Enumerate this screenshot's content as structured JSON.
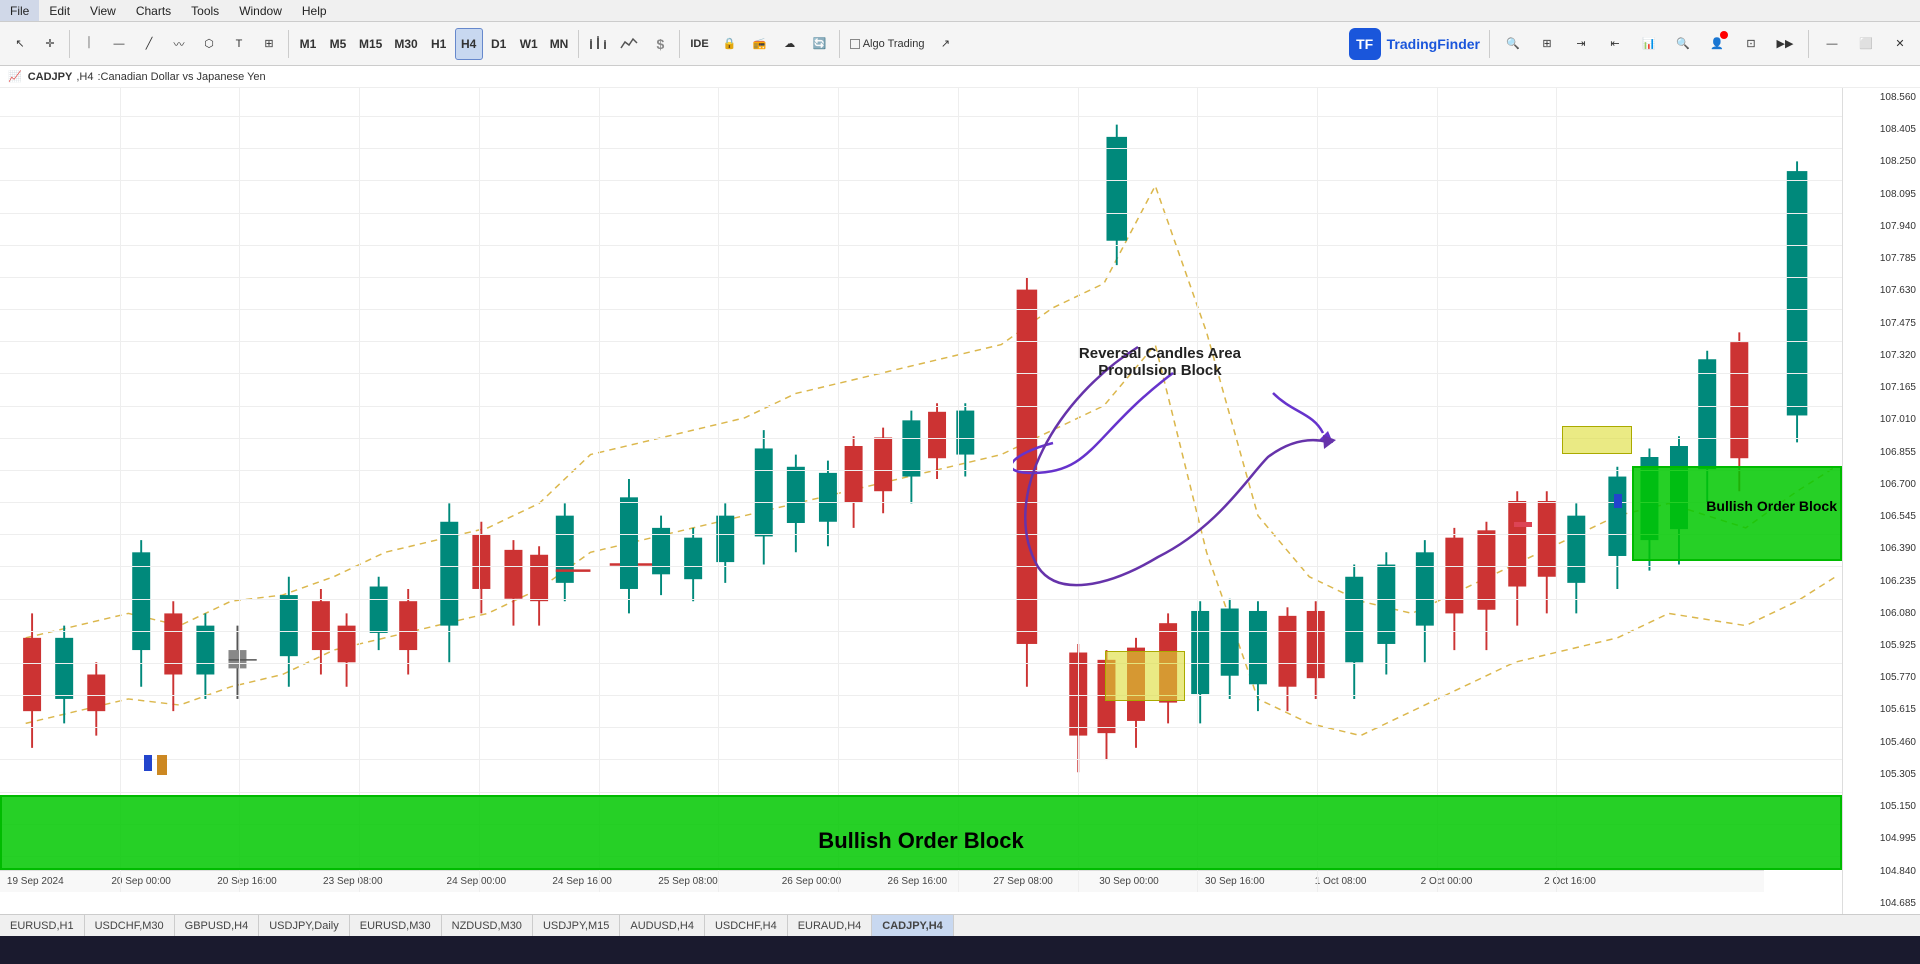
{
  "menu": {
    "items": [
      "File",
      "Edit",
      "View",
      "Charts",
      "Tools",
      "Window",
      "Help"
    ]
  },
  "toolbar": {
    "tools": [
      {
        "name": "cursor",
        "label": "↖",
        "active": false
      },
      {
        "name": "crosshair",
        "label": "✛",
        "active": false
      },
      {
        "name": "line-v",
        "label": "⏐",
        "active": false
      },
      {
        "name": "line-h",
        "label": "—",
        "active": false
      },
      {
        "name": "line-diag",
        "label": "╱",
        "active": false
      },
      {
        "name": "path",
        "label": "〰",
        "active": false
      },
      {
        "name": "shapes",
        "label": "⬡",
        "active": false
      },
      {
        "name": "text",
        "label": "T",
        "active": false
      },
      {
        "name": "fibonacci",
        "label": "⊞",
        "active": false
      }
    ],
    "timeframes": [
      "M1",
      "M5",
      "M15",
      "M30",
      "H1",
      "H4",
      "D1",
      "W1",
      "MN"
    ],
    "active_tf": "H4",
    "right_tools": [
      "IDE",
      "🔒",
      "📻",
      "☁",
      "🔄",
      "Algo Trading",
      "↗"
    ],
    "logo_text": "TradingFinder"
  },
  "chart_header": {
    "symbol": "CADJPY",
    "timeframe": "H4",
    "description": "Canadian Dollar vs Japanese Yen"
  },
  "price_axis": {
    "labels": [
      "108.560",
      "108.405",
      "108.250",
      "108.095",
      "107.940",
      "107.785",
      "107.630",
      "107.475",
      "107.320",
      "107.165",
      "107.010",
      "106.855",
      "106.700",
      "106.545",
      "106.390",
      "106.235",
      "106.080",
      "105.925",
      "105.770",
      "105.615",
      "105.460",
      "105.305",
      "105.150",
      "104.995",
      "104.840",
      "104.685"
    ]
  },
  "time_axis": {
    "labels": [
      {
        "text": "19 Sep 2024",
        "pct": 2
      },
      {
        "text": "20 Sep 00:00",
        "pct": 8
      },
      {
        "text": "20 Sep 16:00",
        "pct": 14
      },
      {
        "text": "23 Sep 08:00",
        "pct": 20
      },
      {
        "text": "24 Sep 00:00",
        "pct": 26
      },
      {
        "text": "24 Sep 16:00",
        "pct": 32
      },
      {
        "text": "25 Sep 08:00",
        "pct": 38
      },
      {
        "text": "26 Sep 00:00",
        "pct": 44
      },
      {
        "text": "26 Sep 16:00",
        "pct": 50
      },
      {
        "text": "27 Sep 08:00",
        "pct": 56
      },
      {
        "text": "30 Sep 00:00",
        "pct": 62
      },
      {
        "text": "30 Sep 16:00",
        "pct": 68
      },
      {
        "text": "1 Oct 08:00",
        "pct": 74
      },
      {
        "text": "2 Oct 00:00",
        "pct": 80
      },
      {
        "text": "2 Oct 16:00",
        "pct": 87
      }
    ]
  },
  "annotations": {
    "bullish_order_block_bottom_label": "Bullish Order Block",
    "bullish_order_block_right_label": "Bullish Order Block",
    "reversal_title": "Reversal Candles Area",
    "propulsion_subtitle": "Propulsion Block"
  },
  "symbol_tabs": [
    {
      "label": "EURUSD,H1",
      "active": false
    },
    {
      "label": "USDCHF,M30",
      "active": false
    },
    {
      "label": "GBPUSD,H4",
      "active": false
    },
    {
      "label": "USDJPY,Daily",
      "active": false
    },
    {
      "label": "EURUSD,M30",
      "active": false
    },
    {
      "label": "NZDUSD,M30",
      "active": false
    },
    {
      "label": "USDJPY,M15",
      "active": false
    },
    {
      "label": "AUDUSD,H4",
      "active": false
    },
    {
      "label": "USDCHF,H4",
      "active": false
    },
    {
      "label": "EURAUD,H4",
      "active": false
    },
    {
      "label": "CADJPY,H4",
      "active": true
    }
  ]
}
